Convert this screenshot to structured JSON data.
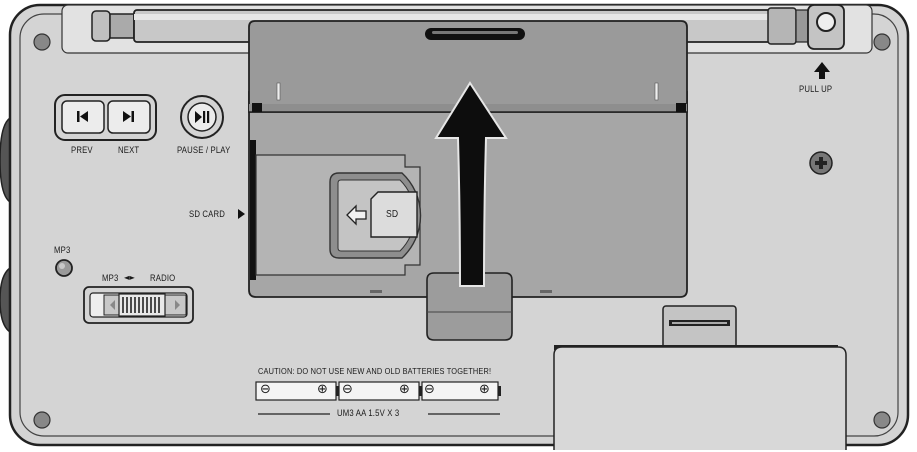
{
  "controls": {
    "prev_label": "PREV",
    "next_label": "NEXT",
    "pause_play_label": "PAUSE / PLAY",
    "sd_card_label": "SD CARD",
    "sd_slot_label": "SD",
    "mp3_led_label": "MP3",
    "switch_left_label": "MP3",
    "switch_arrows": "◄►",
    "switch_right_label": "RADIO"
  },
  "antenna": {
    "pull_label": "PULL UP"
  },
  "battery": {
    "caution_text": "CAUTION: DO NOT USE NEW AND OLD BATTERIES TOGETHER!",
    "spec_text": "UM3 AA 1.5V X 3",
    "cells": [
      {
        "minus": "⊖",
        "plus": "⊕"
      },
      {
        "minus": "⊖",
        "plus": "⊕"
      },
      {
        "minus": "⊖",
        "plus": "⊕"
      }
    ]
  },
  "colors": {
    "body": "#d4d4d4",
    "door": "#9e9e9e",
    "outline": "#222222"
  }
}
